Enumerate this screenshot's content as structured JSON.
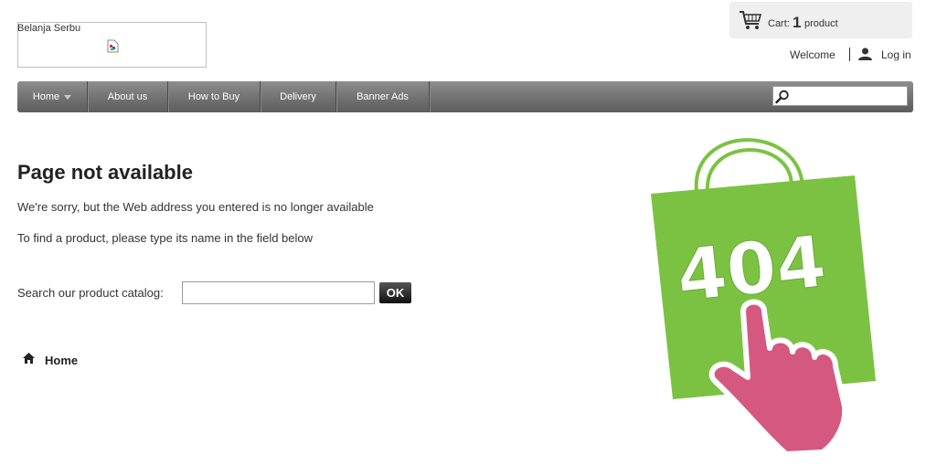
{
  "header": {
    "logo_alt_text": "Belanja Serbu",
    "cart": {
      "label": "Cart:",
      "quantity": "1",
      "unit": "product",
      "icon": "shopping-cart-icon"
    },
    "welcome": "Welcome",
    "login": "Log in"
  },
  "nav": {
    "items": [
      {
        "label": "Home",
        "has_dropdown": true
      },
      {
        "label": "About us"
      },
      {
        "label": "How to Buy"
      },
      {
        "label": "Delivery"
      },
      {
        "label": "Banner Ads"
      }
    ],
    "search": {
      "placeholder": "",
      "value": "",
      "icon": "magnifier-icon"
    }
  },
  "main": {
    "title": "Page not available",
    "message1": "We're sorry, but the Web address you entered is no longer available",
    "message2": "To find a product, please type its name in the field below",
    "search_label": "Search our product catalog:",
    "search_value": "",
    "ok_label": "OK",
    "home_link": "Home"
  },
  "illustration": {
    "text": "404",
    "bag_color": "#7cc242",
    "hand_color": "#d5587f"
  }
}
